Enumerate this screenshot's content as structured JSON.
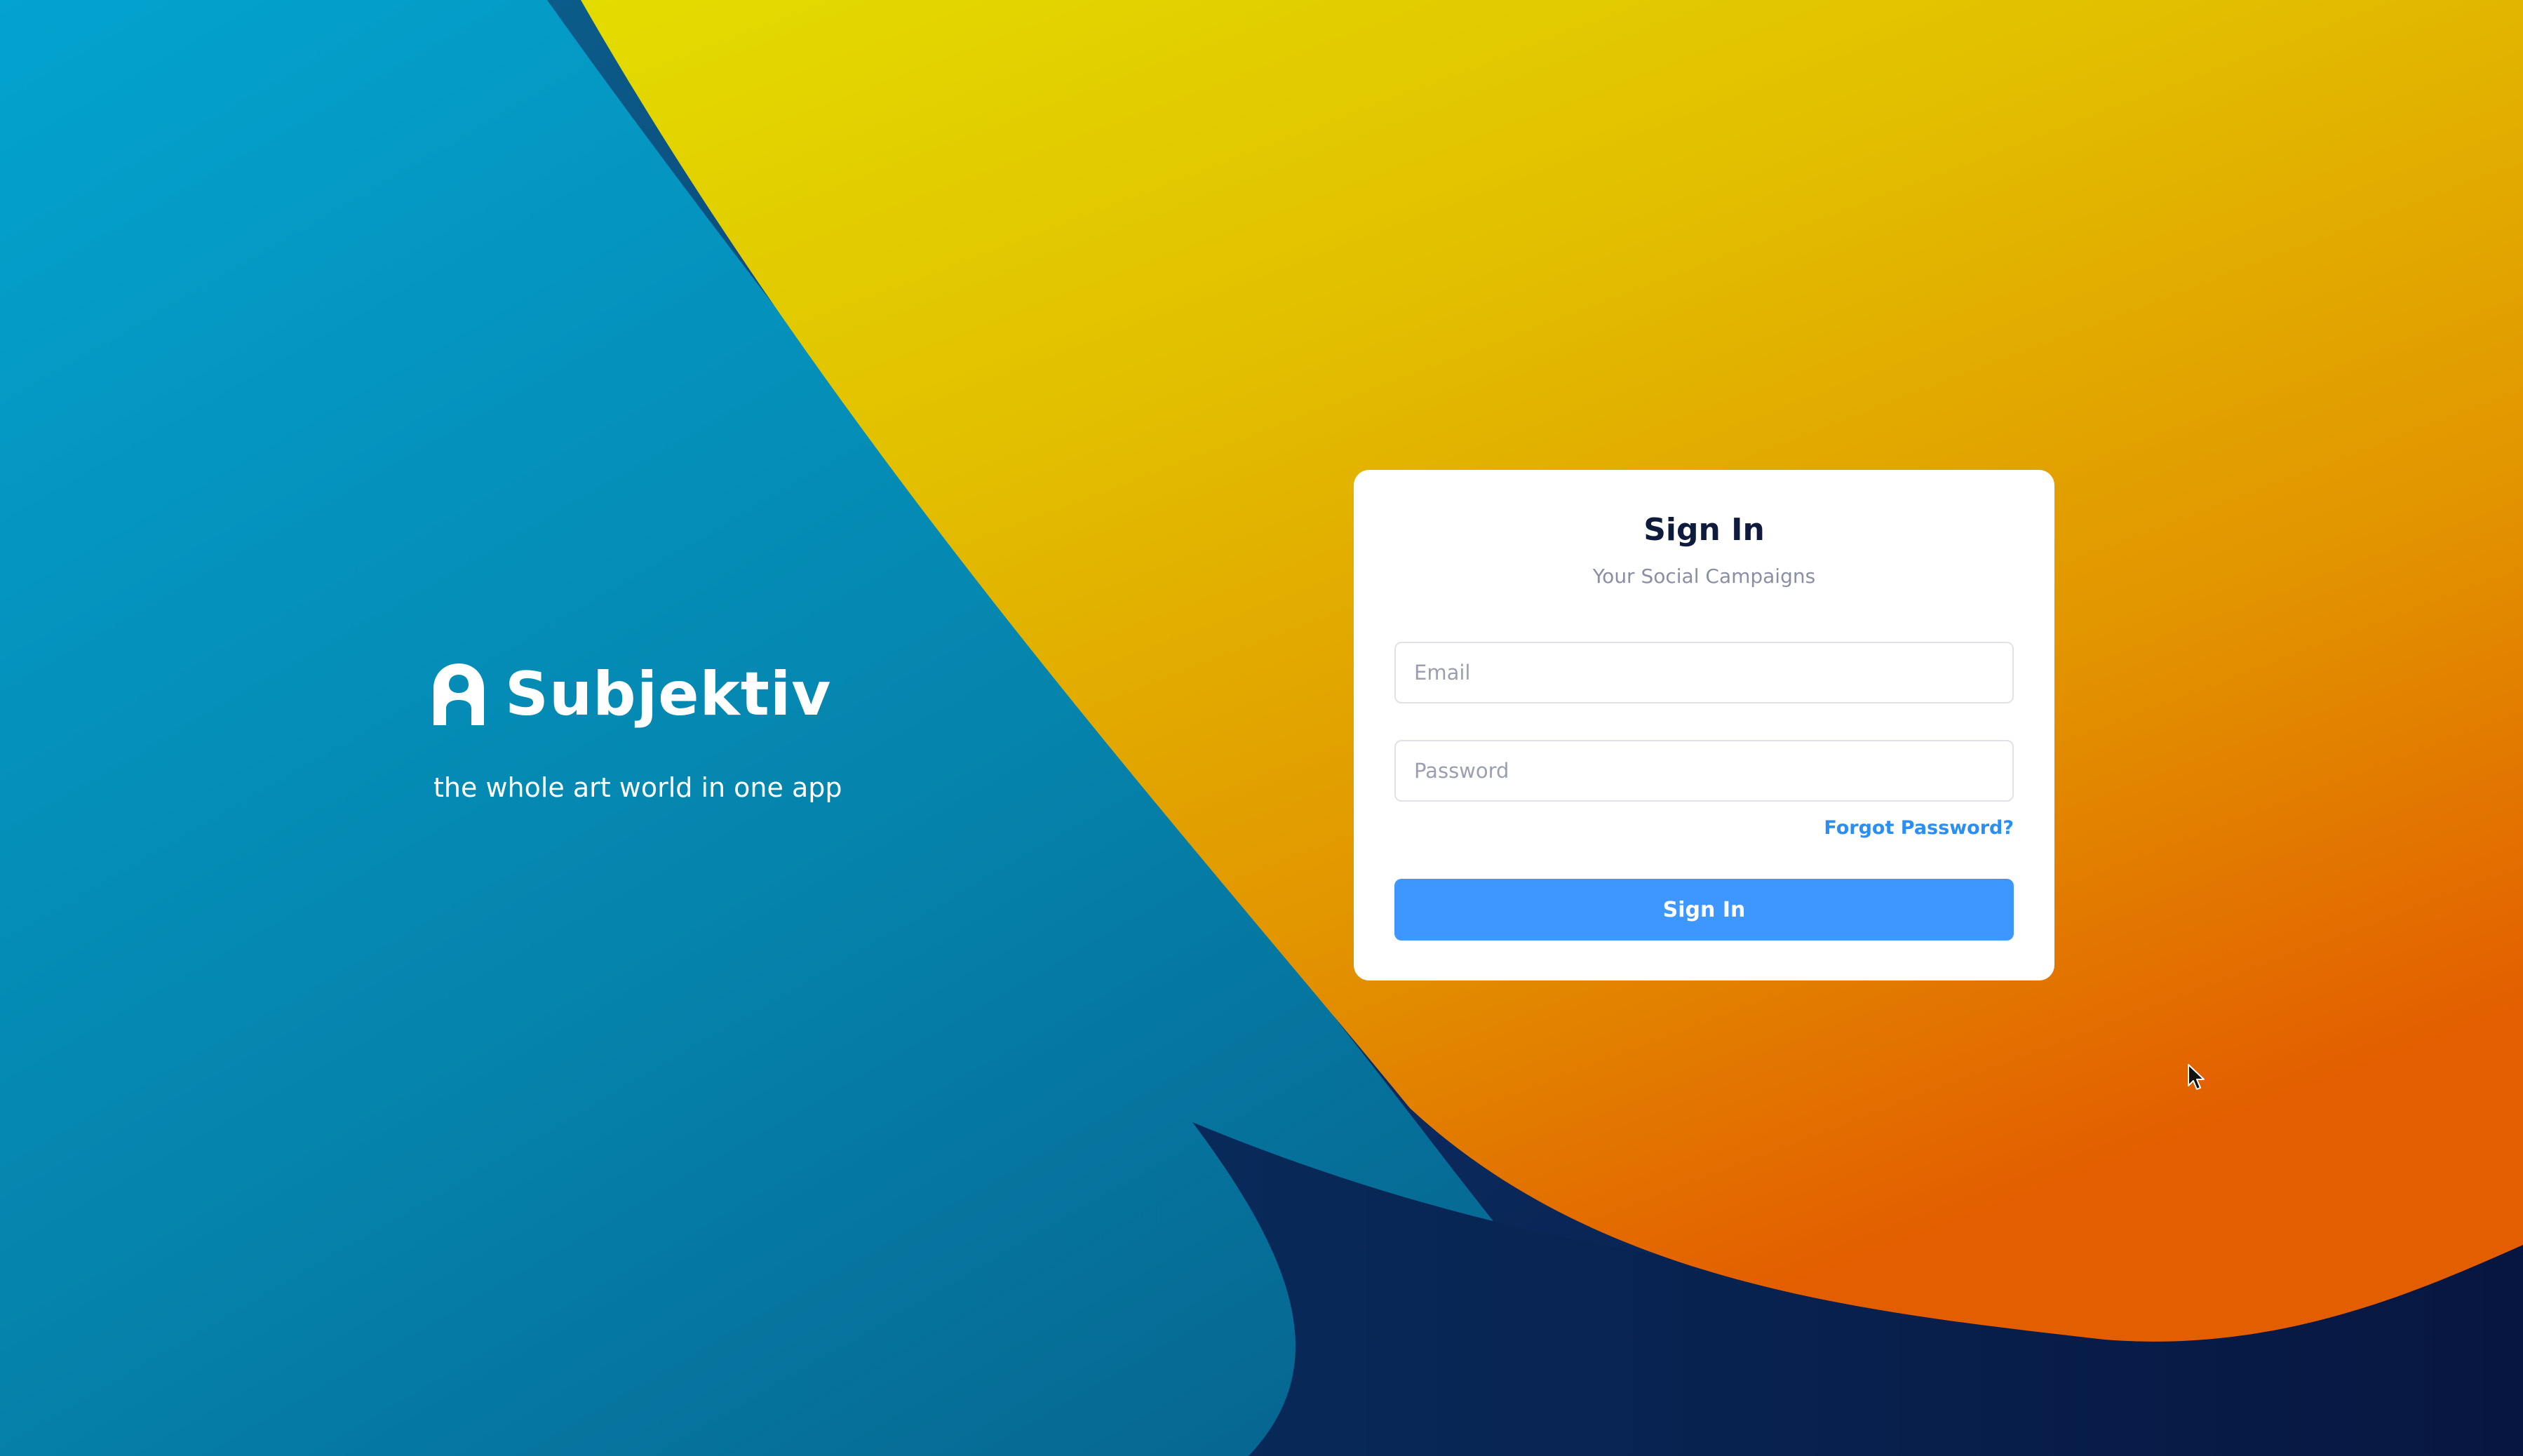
{
  "brand": {
    "name": "Subjektiv",
    "tagline": "the whole art world in one app",
    "logo_icon": "subjektiv-arch-logo"
  },
  "sign_in": {
    "title": "Sign In",
    "subtitle": "Your Social Campaigns",
    "email_placeholder": "Email",
    "email_value": "",
    "password_placeholder": "Password",
    "password_value": "",
    "forgot_label": "Forgot Password?",
    "submit_label": "Sign In"
  },
  "colors": {
    "accent": "#3e97ff",
    "link": "#2b8ef2",
    "card_background": "#ffffff",
    "title": "#0f1b3d",
    "background_teal": "#0496c4",
    "background_navy": "#0a2455",
    "background_yellow": "#e3d800",
    "background_orange": "#e36400"
  },
  "icons": {
    "cursor": "mouse-pointer-icon"
  }
}
